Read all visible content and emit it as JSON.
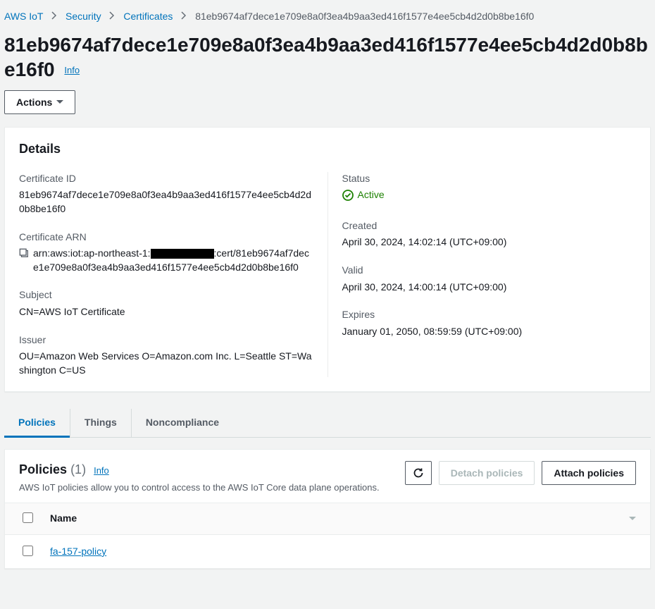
{
  "breadcrumb": {
    "root": "AWS IoT",
    "security": "Security",
    "certificates": "Certificates",
    "current": "81eb9674af7dece1e709e8a0f3ea4b9aa3ed416f1577e4ee5cb4d2d0b8be16f0"
  },
  "title": "81eb9674af7dece1e709e8a0f3ea4b9aa3ed416f1577e4ee5cb4d2d0b8be16f0",
  "info_label": "Info",
  "actions_label": "Actions",
  "details": {
    "heading": "Details",
    "cert_id_label": "Certificate ID",
    "cert_id_value": "81eb9674af7dece1e709e8a0f3ea4b9aa3ed416f1577e4ee5cb4d2d0b8be16f0",
    "cert_arn_label": "Certificate ARN",
    "cert_arn_prefix": "arn:aws:iot:ap-northeast-1:",
    "cert_arn_suffix": ":cert/81eb9674af7dece1e709e8a0f3ea4b9aa3ed416f1577e4ee5cb4d2d0b8be16f0",
    "subject_label": "Subject",
    "subject_value": "CN=AWS IoT Certificate",
    "issuer_label": "Issuer",
    "issuer_value": "OU=Amazon Web Services O=Amazon.com Inc. L=Seattle ST=Washington C=US",
    "status_label": "Status",
    "status_value": "Active",
    "created_label": "Created",
    "created_value": "April 30, 2024, 14:02:14 (UTC+09:00)",
    "valid_label": "Valid",
    "valid_value": "April 30, 2024, 14:00:14 (UTC+09:00)",
    "expires_label": "Expires",
    "expires_value": "January 01, 2050, 08:59:59 (UTC+09:00)"
  },
  "tabs": {
    "policies": "Policies",
    "things": "Things",
    "noncompliance": "Noncompliance"
  },
  "policies": {
    "title": "Policies",
    "count": "(1)",
    "info": "Info",
    "desc": "AWS IoT policies allow you to control access to the AWS IoT Core data plane operations.",
    "detach": "Detach policies",
    "attach": "Attach policies",
    "name_header": "Name",
    "rows": [
      {
        "name": "fa-157-policy"
      }
    ]
  }
}
